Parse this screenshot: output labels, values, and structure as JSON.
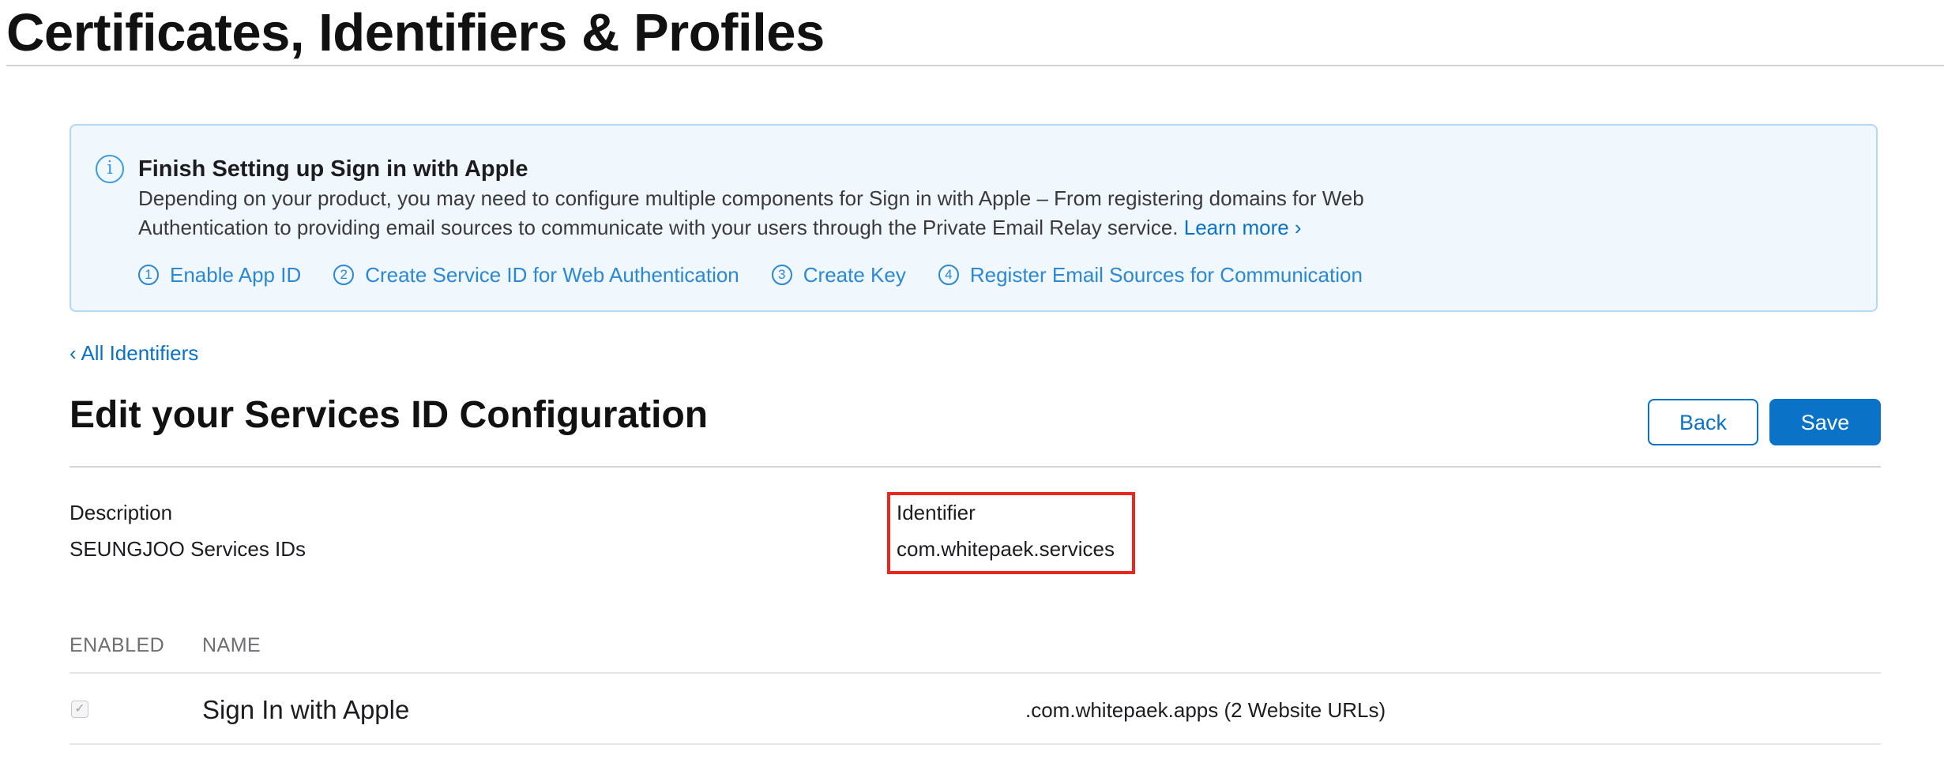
{
  "page": {
    "title": "Certificates, Identifiers & Profiles"
  },
  "banner": {
    "icon": "info-icon",
    "title": "Finish Setting up Sign in with Apple",
    "body": "Depending on your product, you may need to configure multiple components for Sign in with Apple – From registering domains for Web Authentication to providing email sources to communicate with your users through the Private Email Relay service.",
    "learn_more": "Learn more ›",
    "steps": [
      {
        "number": "1",
        "label": "Enable App ID"
      },
      {
        "number": "2",
        "label": "Create Service ID for Web Authentication"
      },
      {
        "number": "3",
        "label": "Create Key"
      },
      {
        "number": "4",
        "label": "Register Email Sources for Communication"
      }
    ]
  },
  "breadcrumb": {
    "label": "‹ All Identifiers"
  },
  "section": {
    "title": "Edit your Services ID Configuration",
    "back_label": "Back",
    "save_label": "Save"
  },
  "fields": {
    "description": {
      "label": "Description",
      "value": "SEUNGJOO Services IDs"
    },
    "identifier": {
      "label": "Identifier",
      "value": "com.whitepaek.services"
    }
  },
  "table": {
    "columns": [
      "ENABLED",
      "NAME"
    ],
    "rows": [
      {
        "enabled": true,
        "check_glyph": "✓",
        "name": "Sign In with Apple",
        "detail": ".com.whitepaek.apps (2 Website URLs)"
      }
    ]
  },
  "colors": {
    "link": "#0a72c7",
    "banner_background": "#f0f7fd",
    "banner_border": "#b4d8f3",
    "highlight": "#e8281f"
  }
}
